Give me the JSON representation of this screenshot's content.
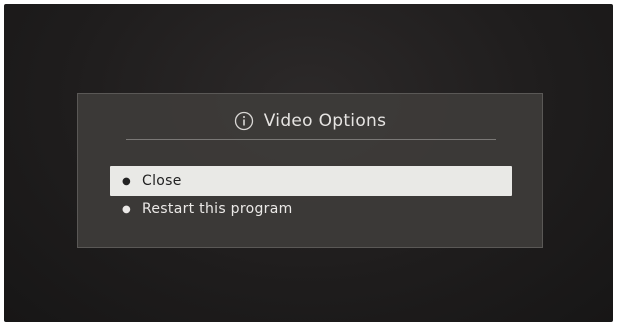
{
  "dialog": {
    "title": "Video Options",
    "icon": "info-icon"
  },
  "menu": {
    "items": [
      {
        "label": "Close",
        "selected": true
      },
      {
        "label": "Restart this program",
        "selected": false
      }
    ]
  },
  "colors": {
    "background": "#1f1d1d",
    "dialog": "#3e3c3a",
    "selected_item": "#e9e9e6",
    "text": "#ebe9e7"
  }
}
